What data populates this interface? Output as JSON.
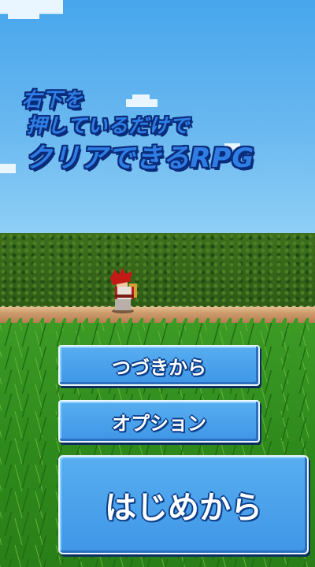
{
  "title": {
    "line1": "右下を",
    "line2": "押しているだけで",
    "line3": "クリアできるRPG"
  },
  "menu": {
    "continue_label": "つづきから",
    "options_label": "オプション",
    "new_game_label": "はじめから"
  },
  "colors": {
    "button": "#4aa3ec",
    "button_text_outline": "#0d3f8a",
    "title_fill": "#2f7ee6",
    "sky": "#6ab8f0",
    "forest": "#2d5a16",
    "grass": "#2f8a1c",
    "path": "#c9955f"
  }
}
